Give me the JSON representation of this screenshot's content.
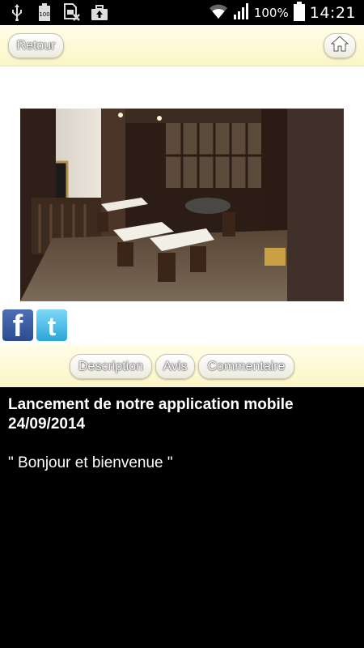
{
  "status_bar": {
    "icons_left": [
      "usb-icon",
      "battery-100-icon",
      "sim-off-icon",
      "briefcase-upload-icon"
    ],
    "battery_percent": "100%",
    "time": "14:21"
  },
  "header": {
    "back_label": "Retour",
    "home_icon": "home-icon"
  },
  "photo": {
    "description_icon": "restaurant-photo"
  },
  "social": {
    "facebook_label": "f",
    "twitter_label": "t"
  },
  "tabs": [
    {
      "label": "Description"
    },
    {
      "label": "Avis"
    },
    {
      "label": "Commentaire"
    }
  ],
  "article": {
    "title": "Lancement de notre application mobile",
    "date": "24/09/2014",
    "body": "\" Bonjour et bienvenue \""
  },
  "colors": {
    "header_bg": "#fdf9d4",
    "content_bg": "#ffffff",
    "article_bg": "#000000",
    "facebook": "#3b5998",
    "twitter": "#3ab4e6"
  }
}
